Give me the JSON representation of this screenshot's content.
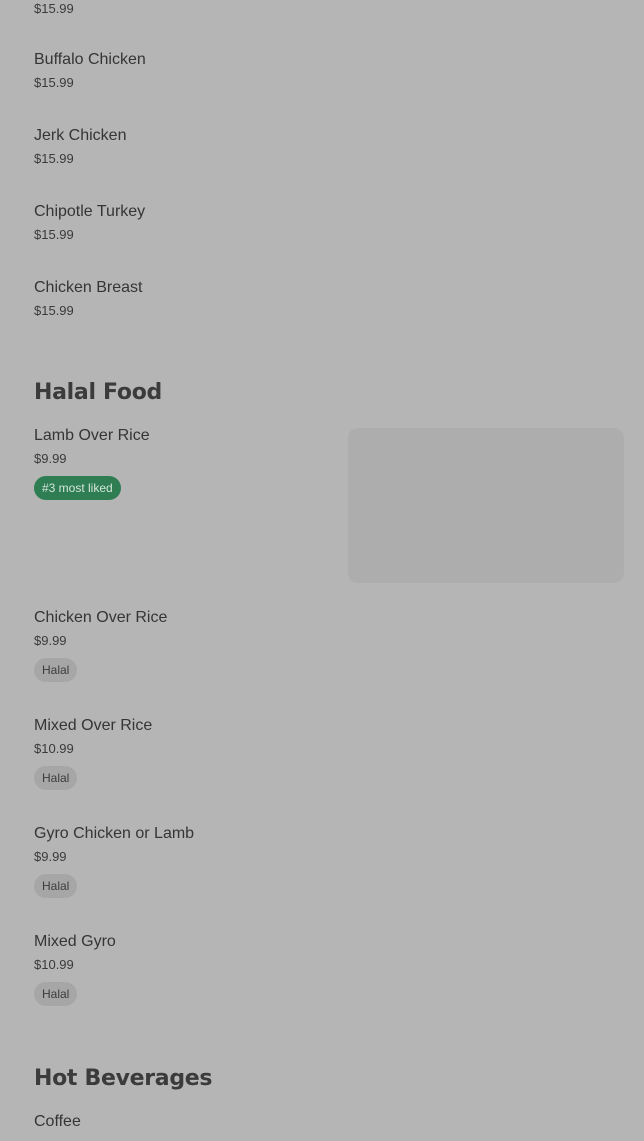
{
  "top_partial": {
    "price": "$15.99"
  },
  "sections": [
    {
      "title": "",
      "items": [
        {
          "name": "Buffalo Chicken",
          "price": "$15.99"
        },
        {
          "name": "Jerk Chicken",
          "price": "$15.99"
        },
        {
          "name": "Chipotle Turkey",
          "price": "$15.99"
        },
        {
          "name": "Chicken Breast",
          "price": "$15.99"
        }
      ]
    },
    {
      "title": "Halal Food",
      "items": [
        {
          "name": "Lamb Over Rice",
          "price": "$9.99",
          "badge": "#3 most liked",
          "has_image": true
        },
        {
          "name": "Chicken Over Rice",
          "price": "$9.99",
          "tag": "Halal"
        },
        {
          "name": "Mixed Over Rice",
          "price": "$10.99",
          "tag": "Halal"
        },
        {
          "name": "Gyro Chicken or Lamb",
          "price": "$9.99",
          "tag": "Halal"
        },
        {
          "name": "Mixed Gyro",
          "price": "$10.99",
          "tag": "Halal"
        }
      ]
    },
    {
      "title": "Hot Beverages",
      "items": [
        {
          "name": "Coffee"
        }
      ]
    }
  ],
  "colors": {
    "background": "#b5b5b5",
    "liked_badge": "#2e7d53",
    "tag_badge": "#a6a6a6"
  }
}
